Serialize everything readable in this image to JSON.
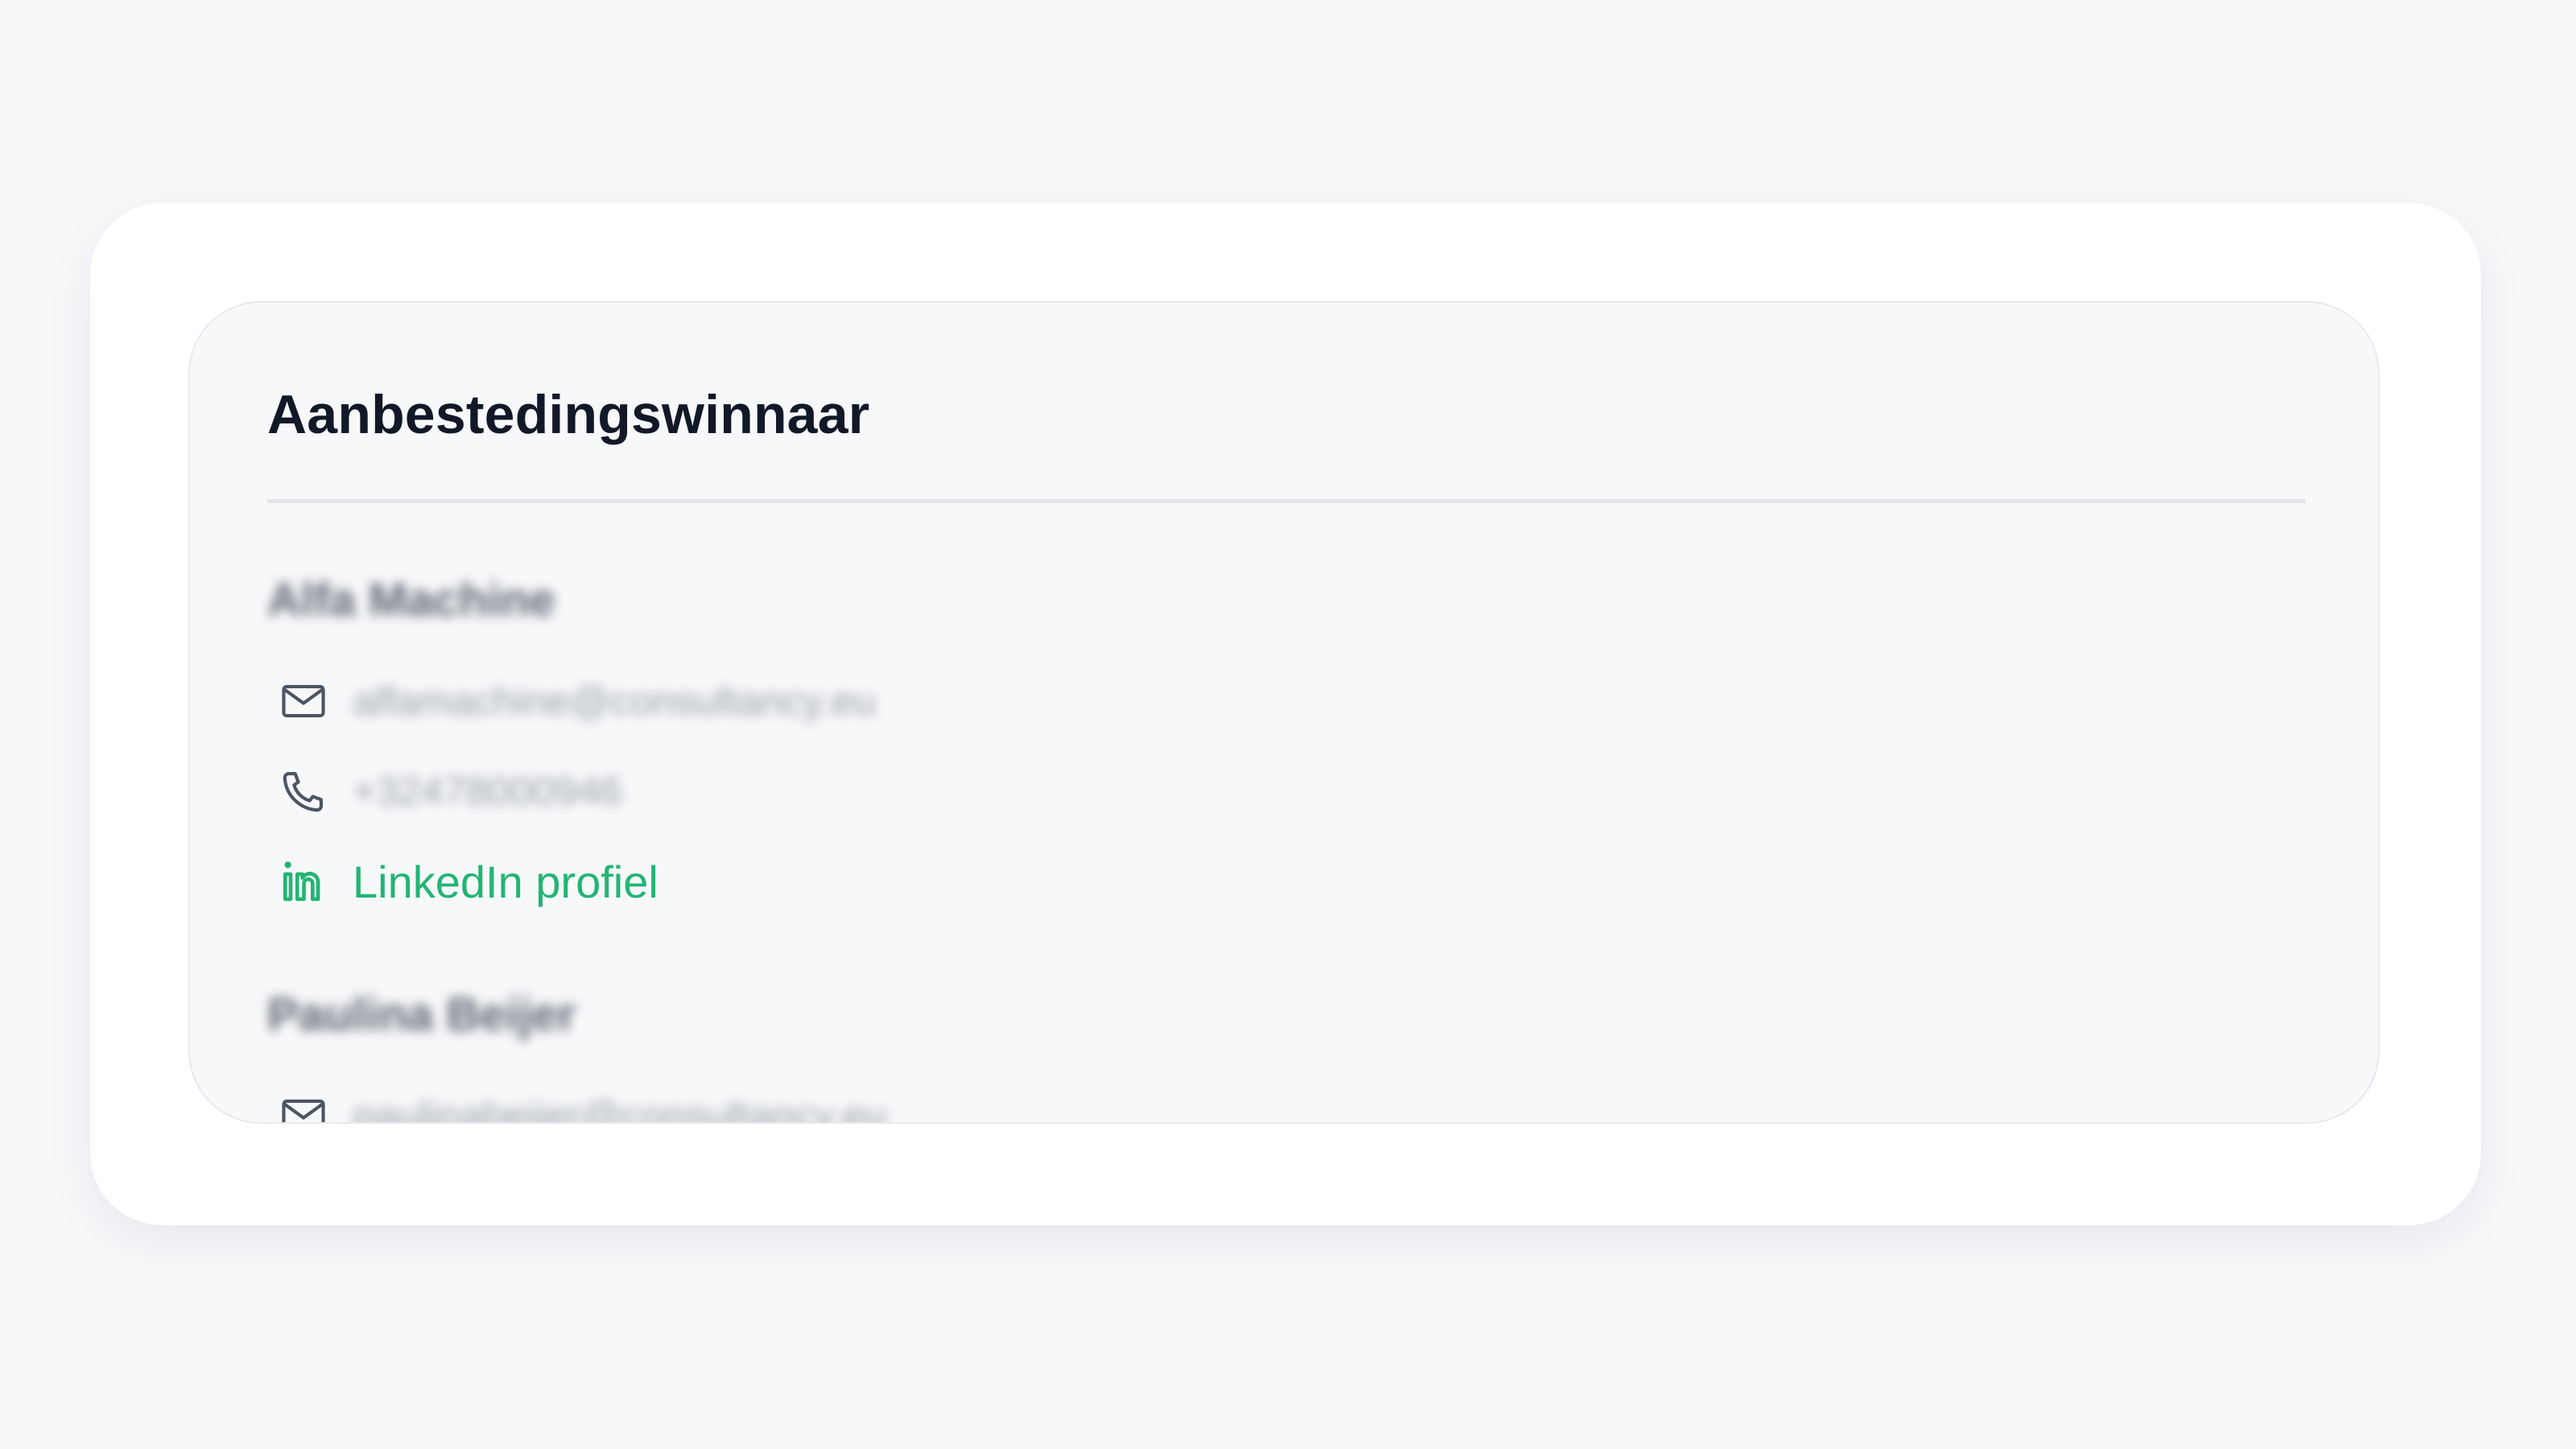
{
  "card": {
    "title": "Aanbestedingswinnaar"
  },
  "contacts": [
    {
      "name": "Alfa Machine",
      "email": "alfamachine@consultancy.eu",
      "phone": "+32478000946",
      "linkedin_label": "LinkedIn profiel"
    },
    {
      "name": "Paulina Beijer",
      "email": "paulinabeijer@consultancy.eu"
    }
  ],
  "colors": {
    "accent": "#22b573",
    "title": "#111827",
    "panel_bg": "#f7f8fa",
    "icon": "#4b5563"
  },
  "icons": {
    "email": "mail-icon",
    "phone": "phone-icon",
    "linkedin": "linkedin-icon"
  }
}
